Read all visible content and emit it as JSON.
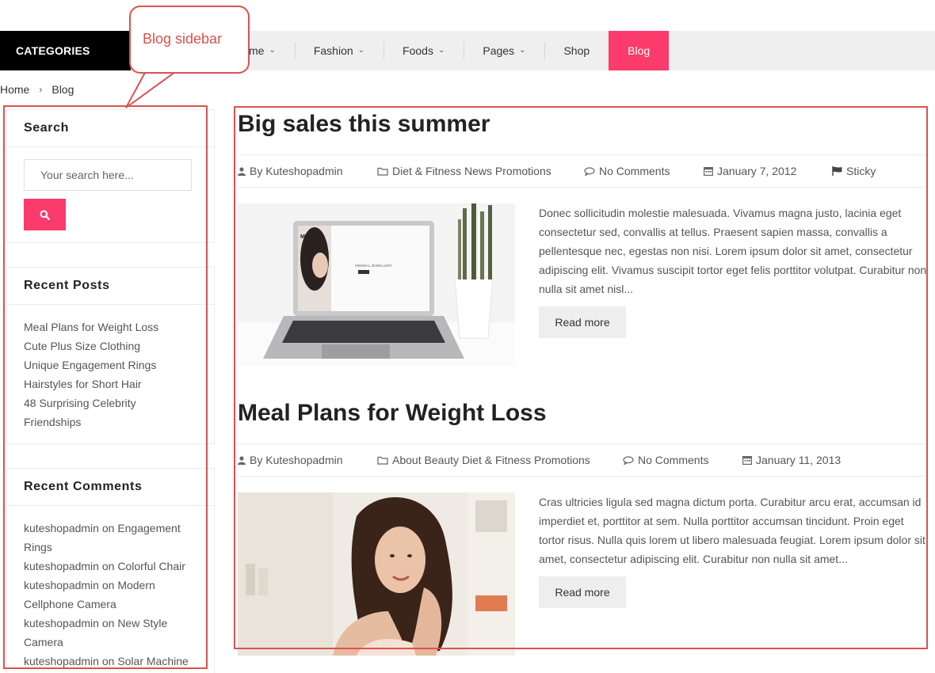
{
  "nav": {
    "categories_label": "CATEGORIES",
    "items": [
      {
        "label": "me"
      },
      {
        "label": "Fashion"
      },
      {
        "label": "Foods"
      },
      {
        "label": "Pages"
      },
      {
        "label": "Shop"
      },
      {
        "label": "Blog"
      }
    ],
    "active_color": "#fa3b6b"
  },
  "callout": {
    "text": "Blog sidebar",
    "color": "#d9534f"
  },
  "breadcrumb": {
    "home": "Home",
    "current": "Blog"
  },
  "sidebar": {
    "search": {
      "title": "Search",
      "placeholder": "Your search here..."
    },
    "recent_posts": {
      "title": "Recent Posts",
      "items": [
        "Meal Plans for Weight Loss",
        "Cute Plus Size Clothing",
        "Unique Engagement Rings",
        "Hairstyles for Short Hair",
        "48 Surprising Celebrity",
        "Friendships"
      ]
    },
    "recent_comments": {
      "title": "Recent Comments",
      "lines": [
        {
          "author": "kuteshopadmin",
          "on": "on",
          "post": "Engagement"
        },
        {
          "post": "Rings"
        },
        {
          "author": "kuteshopadmin",
          "on": "on",
          "post": "Colorful Chair"
        },
        {
          "author": "kuteshopadmin",
          "on": "on",
          "post": "Modern"
        },
        {
          "post": "Cellphone Camera"
        },
        {
          "author": "kuteshopadmin",
          "on": "on",
          "post": "New Style"
        },
        {
          "post": "Camera"
        },
        {
          "author": "kuteshopadmin",
          "on": "on",
          "post": "Solar Machine"
        }
      ]
    }
  },
  "posts": [
    {
      "title": "Big sales this summer",
      "author": "By Kuteshopadmin",
      "categories": "Diet & Fitness News Promotions",
      "comments": "No Comments",
      "date": "January 7, 2012",
      "sticky": "Sticky",
      "excerpt": "Donec sollicitudin molestie malesuada. Vivamus magna justo, lacinia eget consectetur sed, convallis at tellus. Praesent sapien massa, convallis a pellentesque nec, egestas non nisi. Lorem ipsum dolor sit amet, consectetur adipiscing elit. Vivamus suscipit tortor eget felis porttitor volutpat. Curabitur non nulla sit amet nisl...",
      "read_more": "Read more",
      "screen_text": "MINIMAL JEWELLERY",
      "screen_logo": "MCH"
    },
    {
      "title": "Meal Plans for Weight Loss",
      "author": "By Kuteshopadmin",
      "categories": "About Beauty Diet & Fitness Promotions",
      "comments": "No Comments",
      "date": "January 11, 2013",
      "excerpt": "Cras ultricies ligula sed magna dictum porta. Curabitur arcu erat, accumsan id imperdiet et, porttitor at sem. Nulla porttitor accumsan tincidunt. Proin eget tortor risus. Nulla quis lorem ut libero malesuada feugiat. Lorem ipsum dolor sit amet, consectetur adipiscing elit. Curabitur non nulla sit amet...",
      "read_more": "Read more"
    }
  ]
}
